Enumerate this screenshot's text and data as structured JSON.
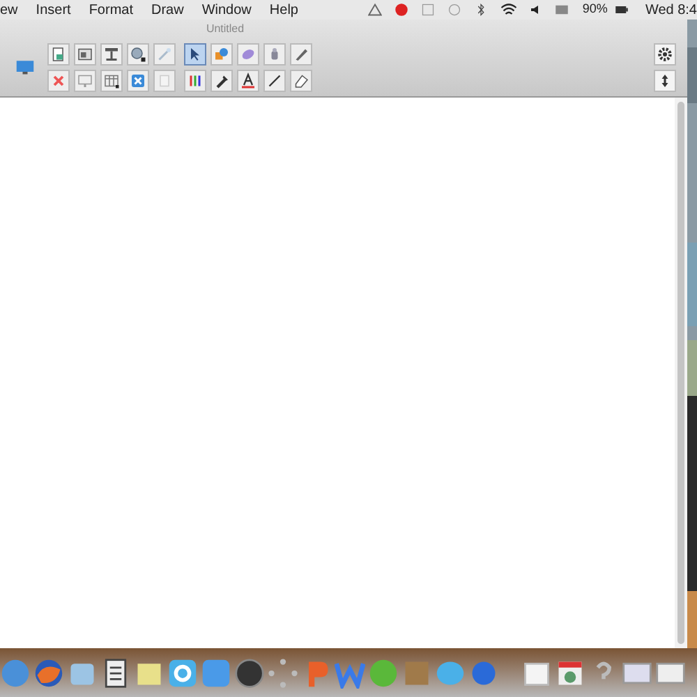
{
  "menu_bar": {
    "items": [
      "ew",
      "Insert",
      "Format",
      "Draw",
      "Window",
      "Help"
    ],
    "battery": "90%",
    "clock": "Wed 8:4"
  },
  "window": {
    "title": "Untitled"
  },
  "tools": [
    {
      "selected": true
    },
    {
      "selected": false
    },
    {
      "selected": false
    },
    {
      "selected": false
    },
    {
      "selected": false
    },
    {
      "selected": false
    },
    {
      "selected": false
    },
    {
      "selected": false
    },
    {
      "selected": false
    },
    {
      "selected": false
    }
  ]
}
